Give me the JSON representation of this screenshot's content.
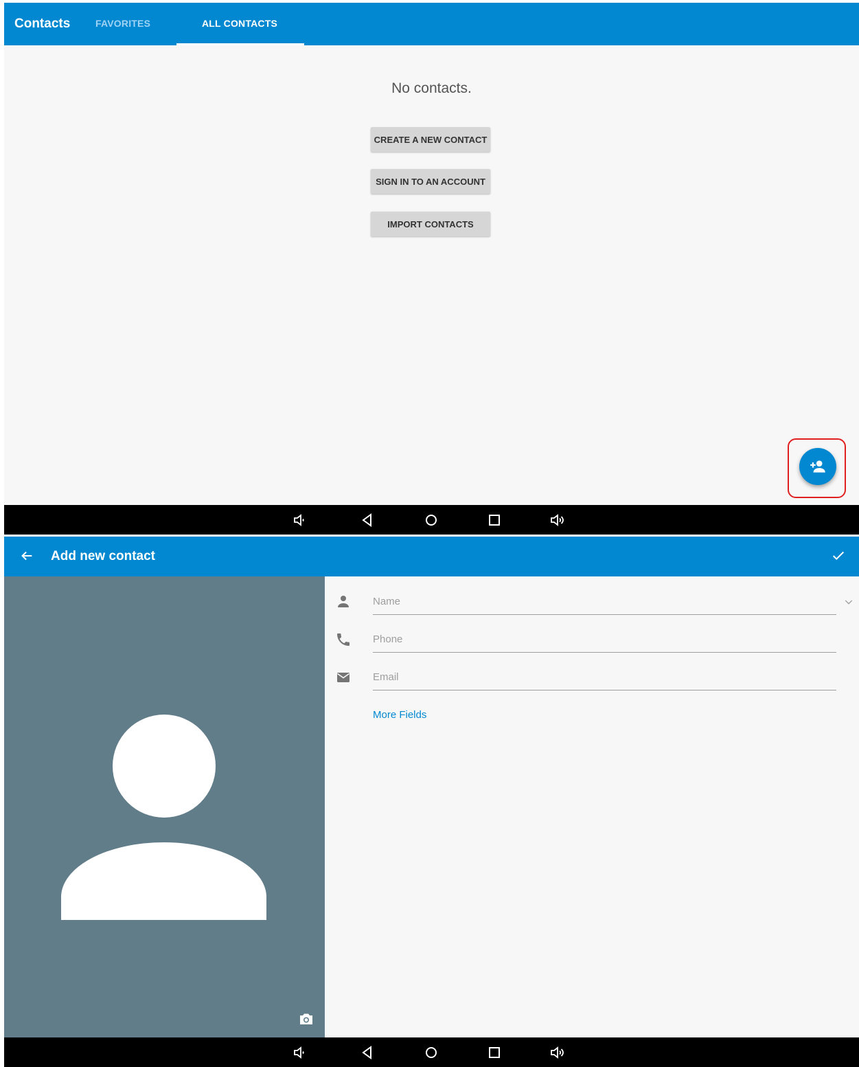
{
  "screen1": {
    "appbar": {
      "title": "Contacts",
      "tabs": [
        {
          "label": "FAVORITES",
          "selected": false
        },
        {
          "label": "ALL CONTACTS",
          "selected": true
        }
      ]
    },
    "empty_message": "No contacts.",
    "buttons": {
      "create": "CREATE A NEW CONTACT",
      "sign_in": "SIGN IN TO AN ACCOUNT",
      "import": "IMPORT CONTACTS"
    },
    "fab": {
      "icon": "add-person-icon",
      "highlighted": true
    }
  },
  "screen2": {
    "appbar": {
      "title": "Add new contact",
      "back_icon": "arrow-back-icon",
      "save_icon": "checkmark-icon"
    },
    "fields": {
      "name_placeholder": "Name",
      "phone_placeholder": "Phone",
      "email_placeholder": "Email"
    },
    "more_fields": "More Fields"
  },
  "navbar_icons": [
    "volume-down-icon",
    "back-triangle-icon",
    "home-circle-icon",
    "recents-square-icon",
    "volume-up-icon"
  ],
  "colors": {
    "primary": "#0288d1",
    "photo_bg": "#627d8a",
    "highlight": "#e02020"
  }
}
